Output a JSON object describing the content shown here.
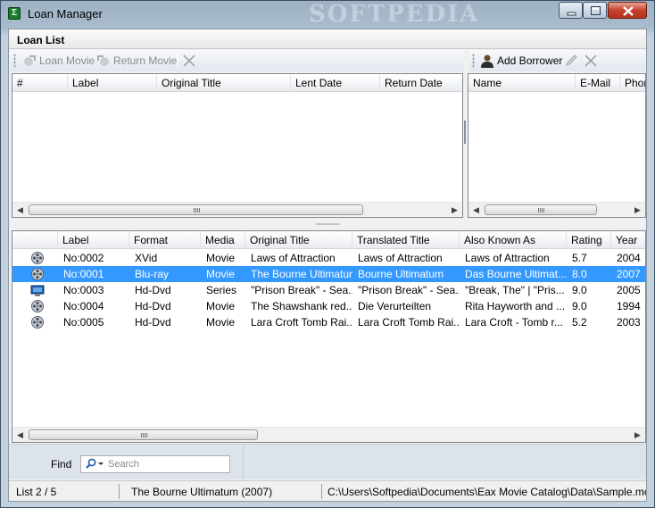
{
  "window": {
    "title": "Loan Manager",
    "watermark": "SOFTPEDIA",
    "accent_color": "#3399ff"
  },
  "loan_list": {
    "header": "Loan List",
    "toolbar": {
      "loan_movie_label": "Loan Movie",
      "return_movie_label": "Return Movie",
      "add_borrower_label": "Add Borrower"
    },
    "loans_columns": [
      "#",
      "Label",
      "Original Title",
      "Lent Date",
      "Return Date"
    ],
    "borrowers_columns": [
      "Name",
      "E-Mail",
      "Phon"
    ]
  },
  "movies": {
    "columns": [
      "Label",
      "Format",
      "Media",
      "Original Title",
      "Translated Title",
      "Also Known As",
      "Rating",
      "Year"
    ],
    "selected_index": 1,
    "rows": [
      {
        "icon": "film-reel-icon",
        "label": "No:0002",
        "format": "XVid",
        "media": "Movie",
        "original_title": "Laws of Attraction",
        "translated_title": "Laws of Attraction",
        "aka": "Laws of Attraction",
        "rating": "5.7",
        "year": "2004"
      },
      {
        "icon": "film-reel-icon",
        "label": "No:0001",
        "format": "Blu-ray",
        "media": "Movie",
        "original_title": "The Bourne Ultimatum",
        "translated_title": "Bourne Ultimatum",
        "aka": "Das Bourne Ultimat...",
        "rating": "8.0",
        "year": "2007"
      },
      {
        "icon": "tv-monitor-icon",
        "label": "No:0003",
        "format": "Hd-Dvd",
        "media": "Series",
        "original_title": "\"Prison Break\" - Sea...",
        "translated_title": "\"Prison Break\" - Sea...",
        "aka": "\"Break, The\" | \"Pris...",
        "rating": "9.0",
        "year": "2005"
      },
      {
        "icon": "film-reel-icon",
        "label": "No:0004",
        "format": "Hd-Dvd",
        "media": "Movie",
        "original_title": "The Shawshank red...",
        "translated_title": "Die Verurteilten",
        "aka": "Rita Hayworth and ...",
        "rating": "9.0",
        "year": "1994"
      },
      {
        "icon": "film-reel-icon",
        "label": "No:0005",
        "format": "Hd-Dvd",
        "media": "Movie",
        "original_title": "Lara Croft Tomb Rai...",
        "translated_title": "Lara Croft Tomb Rai...",
        "aka": "Lara Croft - Tomb r...",
        "rating": "5.2",
        "year": "2003"
      }
    ]
  },
  "find": {
    "label": "Find",
    "placeholder": "Search",
    "value": ""
  },
  "status": {
    "position": "List 2 / 5",
    "current_title": "The Bourne Ultimatum (2007)",
    "file_path": "C:\\Users\\Softpedia\\Documents\\Eax Movie Catalog\\Data\\Sample.mc"
  }
}
